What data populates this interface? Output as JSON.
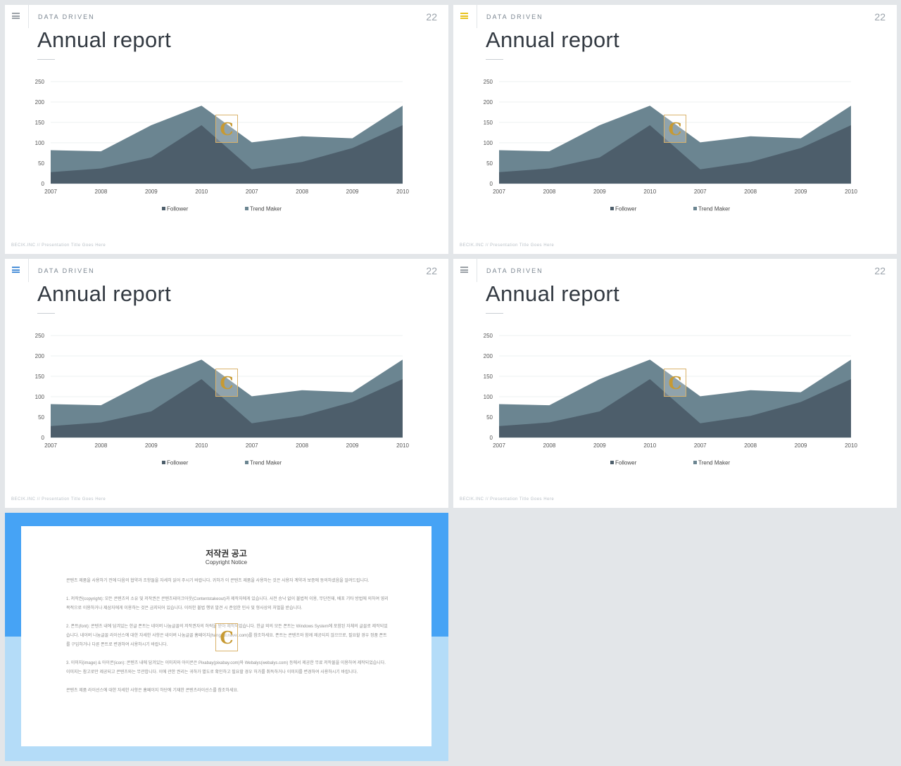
{
  "slides": [
    {
      "eyebrow": "DATA DRIVEN",
      "page": "22",
      "title": "Annual report",
      "footer": "BECIK.INC  //  Presentation  Title  Goes  Here",
      "menu_color": "#9aa0a6"
    },
    {
      "eyebrow": "DATA DRIVEN",
      "page": "22",
      "title": "Annual report",
      "footer": "BECIK.INC  //  Presentation  Title  Goes  Here",
      "menu_color": "#e8c21c"
    },
    {
      "eyebrow": "DATA DRIVEN",
      "page": "22",
      "title": "Annual report",
      "footer": "BECIK.INC  //  Presentation  Title  Goes  Here",
      "menu_color": "#4a8fd8"
    },
    {
      "eyebrow": "DATA DRIVEN",
      "page": "22",
      "title": "Annual report",
      "footer": "BECIK.INC  //  Presentation  Title  Goes  Here",
      "menu_color": "#9aa0a6"
    }
  ],
  "watermark": {
    "letter": "C"
  },
  "chart_data": {
    "type": "area",
    "stacked": false,
    "categories": [
      "2007",
      "2008",
      "2009",
      "2010",
      "2007",
      "2008",
      "2009",
      "2010"
    ],
    "series": [
      {
        "name": "Trend Maker",
        "values": [
          82,
          79,
          143,
          191,
          101,
          116,
          111,
          191
        ],
        "color": "#6b8591"
      },
      {
        "name": "Follower",
        "values": [
          28,
          37,
          64,
          143,
          35,
          53,
          87,
          143
        ],
        "color": "#4d5e6b"
      }
    ],
    "ylim": [
      0,
      250
    ],
    "yticks": [
      0,
      50,
      100,
      150,
      200,
      250
    ],
    "grid": true,
    "legend_position": "bottom",
    "legend_order": [
      "Follower",
      "Trend Maker"
    ]
  },
  "copyright": {
    "title": "저작권 공고",
    "subtitle": "Copyright Notice",
    "paragraphs": [
      "콘텐츠 제품을 사용하기 전에 다음의 협약과 조항들을 자세히 읽어 주시기 바랍니다. 귀하가 이 콘텐츠 제품을 사용하는 것은 사용자 계약과 보증에 동의하셨음을 알려드립니다.",
      "1. 저작권(copyright): 모든 콘텐츠의 소유 및 저작권은 콘텐츠테이크아웃(Contentstakeout)과 제작자에게 있습니다. 사전 승낙 없이 불법적 이용, 무단전재, 배포 기타 방법에 의하여 영리 목적으로 이용하거나 제삼자에게 이용하는 것은 금지되어 있습니다. 이러한 불법 행위 발견 시 준엄한 민사 및 형사상의 처벌을 받습니다.",
      "2. 폰트(font): 콘텐츠 내에 담겨있는 한글 폰트는 네이버 나눔글꼴의 저작권자의 허락을 받아 제작되었습니다. 한글 외의 모든 폰트는 Windows System에 포함된 자체의 글꼴로 제작되었습니다. 네이버 나눔글꼴 라이선스에 대한 자세한 사항은 네이버 나눔글꼴 홈페이지(hangeul.naver.com)를 참조하세요. 폰트는 콘텐츠와 함께 제공되지 않으므로, 필요할 경우 정품 폰트를 구입하거나 다른 폰트로 변경하여 사용하시기 바랍니다.",
      "3. 이미지(image) & 아이콘(icon): 콘텐츠 내에 담겨있는 이미지와 아이콘은 Pixabay(pixabay.com)와 Webalys(webalys.com) 등에서 제공한 무료 저작물을 이용하여 제작되었습니다. 이미지는 참고로만 제공되고 콘텐츠와는 무관합니다. 이에 관한 권리는 귀하가 별도로 확인하고 필요할 경우 허가를 취득하거나 이미지를 변경하여 사용하시기 바랍니다.",
      "콘텐츠 제품 라이선스에 대한 자세한 사항은 홈페이지 하단에 기재한 콘텐츠라이선스를 참조하세요."
    ]
  }
}
